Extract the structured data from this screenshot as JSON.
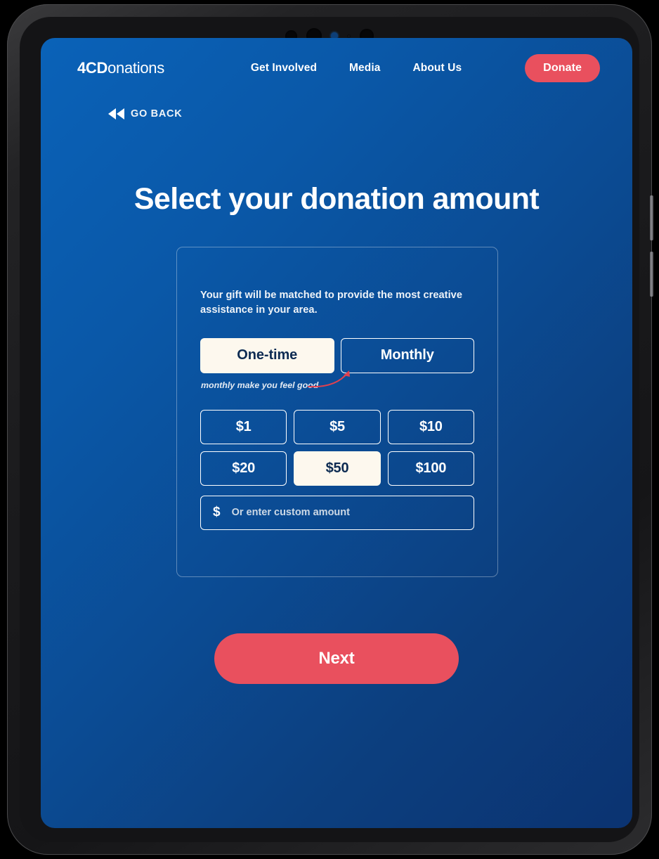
{
  "device": {
    "type": "tablet",
    "camera_lenses": [
      "lens-primary",
      "lens-wide",
      "lens-sensor-blue",
      "lens-micro",
      "lens-ultrawide"
    ],
    "side_buttons": [
      "volume-up",
      "volume-down"
    ]
  },
  "colors": {
    "background_top": "#0a62b8",
    "background_bottom": "#0b3371",
    "accent_red": "#e9505e",
    "selected_cream": "#fdf8ee",
    "selected_text": "#0d2b52",
    "white": "#ffffff"
  },
  "nav": {
    "logo_strong": "4CD",
    "logo_rest": "onations",
    "links": [
      {
        "label": "Get Involved"
      },
      {
        "label": "Media"
      },
      {
        "label": "About Us"
      }
    ],
    "donate_label": "Donate"
  },
  "back": {
    "label": "GO BACK",
    "icon": "rewind-icon"
  },
  "page": {
    "title": "Select your donation amount"
  },
  "card": {
    "description": "Your gift will be matched to provide the most creative assistance in your area.",
    "frequency": {
      "options": [
        {
          "label": "One-time",
          "selected": true
        },
        {
          "label": "Monthly",
          "selected": false
        }
      ]
    },
    "annotation": {
      "text": "monthly make you feel good",
      "arrow_color": "#e0414f",
      "points_to": "Monthly"
    },
    "amounts": [
      {
        "label": "$1",
        "value": 1,
        "selected": false
      },
      {
        "label": "$5",
        "value": 5,
        "selected": false
      },
      {
        "label": "$10",
        "value": 10,
        "selected": false
      },
      {
        "label": "$20",
        "value": 20,
        "selected": false
      },
      {
        "label": "$50",
        "value": 50,
        "selected": true
      },
      {
        "label": "$100",
        "value": 100,
        "selected": false
      }
    ],
    "custom_amount": {
      "currency_symbol": "$",
      "placeholder": "Or enter custom amount",
      "value": ""
    }
  },
  "footer": {
    "next_label": "Next"
  }
}
